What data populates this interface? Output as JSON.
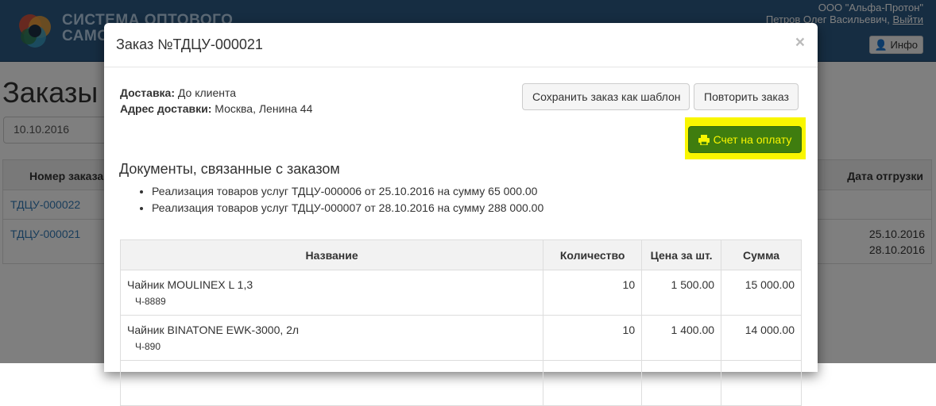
{
  "app": {
    "brand_line1": "СИСТЕМА ОПТОВОГО",
    "brand_line2": "САМОО",
    "company": "ООО \"Альфа-Протон\"",
    "user_name": "Петров Олег Васильевич,",
    "logout": "Выйти",
    "info_button": "Инфо"
  },
  "page": {
    "title": "Заказы",
    "date_filter": "10.10.2016",
    "table_header_number": "Номер заказа",
    "table_header_ship_date": "Дата отгрузки",
    "rows": [
      {
        "number": "ТДЦУ-000022",
        "ship_dates": []
      },
      {
        "number": "ТДЦУ-000021",
        "ship_dates": [
          "25.10.2016",
          "28.10.2016"
        ]
      }
    ]
  },
  "modal": {
    "title": "Заказ №ТДЦУ-000021",
    "close": "×",
    "delivery_label": "Доставка:",
    "delivery_value": "До клиента",
    "address_label": "Адрес доставки:",
    "address_value": "Москва, Ленина 44",
    "save_template_button": "Сохранить заказ как шаблон",
    "repeat_order_button": "Повторить заказ",
    "invoice_button": "Счет на оплату",
    "docs_title": "Документы, связанные с заказом",
    "documents": [
      "Реализация товаров услуг ТДЦУ-000006 от 25.10.2016 на сумму 65 000.00",
      "Реализация товаров услуг ТДЦУ-000007 от 28.10.2016 на сумму 288 000.00"
    ],
    "columns": [
      "Название",
      "Количество",
      "Цена за шт.",
      "Сумма"
    ],
    "items": [
      {
        "name": "Чайник MOULINEX L 1,3",
        "sku": "Ч-8889",
        "qty": "10",
        "price": "1 500.00",
        "sum": "15 000.00"
      },
      {
        "name": "Чайник BINATONE EWK-3000, 2л",
        "sku": "Ч-890",
        "qty": "10",
        "price": "1 400.00",
        "sum": "14 000.00"
      }
    ]
  },
  "colors": {
    "navbar": "#2c5a85",
    "invoice_button_bg": "#3f7d0f",
    "highlight": "#f9f600",
    "link": "#337ab7"
  }
}
